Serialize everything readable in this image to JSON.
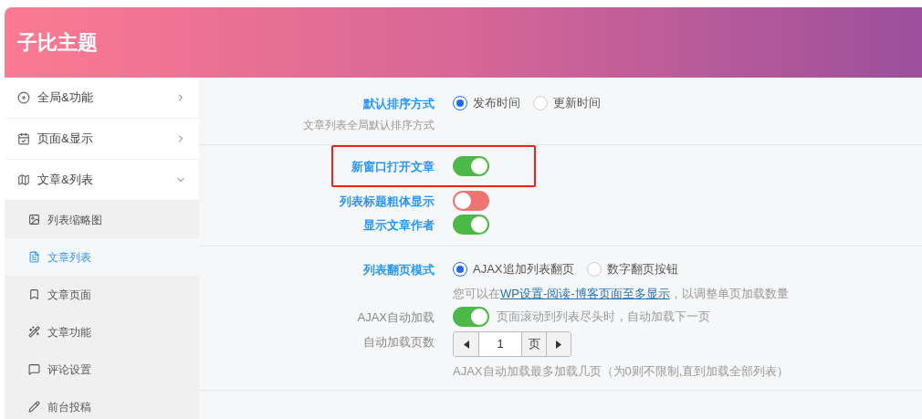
{
  "header": {
    "title": "子比主题"
  },
  "sidebar": {
    "items": [
      {
        "label": "全局&功能",
        "expanded": false
      },
      {
        "label": "页面&显示",
        "expanded": false
      },
      {
        "label": "文章&列表",
        "expanded": true,
        "children": [
          {
            "label": "列表缩略图",
            "selected": false
          },
          {
            "label": "文章列表",
            "selected": true
          },
          {
            "label": "文章页面",
            "selected": false
          },
          {
            "label": "文章功能",
            "selected": false
          },
          {
            "label": "评论设置",
            "selected": false
          },
          {
            "label": "前台投稿",
            "selected": false
          }
        ]
      }
    ]
  },
  "sections": [
    {
      "fields": [
        {
          "kind": "radio",
          "label": "默认排序方式",
          "muted": false,
          "highlighted": false,
          "desc_left": "文章列表全局默认排序方式",
          "options": [
            {
              "label": "发布时间",
              "selected": true
            },
            {
              "label": "更新时间",
              "selected": false
            }
          ]
        }
      ]
    },
    {
      "fields": [
        {
          "kind": "toggle",
          "label": "新窗口打开文章",
          "muted": false,
          "highlighted": true,
          "on": true
        },
        {
          "kind": "toggle",
          "label": "列表标题粗体显示",
          "muted": false,
          "highlighted": false,
          "on": false
        },
        {
          "kind": "toggle",
          "label": "显示文章作者",
          "muted": false,
          "highlighted": false,
          "on": true
        }
      ]
    },
    {
      "fields": [
        {
          "kind": "radio",
          "label": "列表翻页模式",
          "muted": false,
          "highlighted": false,
          "options": [
            {
              "label": "AJAX追加列表翻页",
              "selected": true
            },
            {
              "label": "数字翻页按钮",
              "selected": false
            }
          ],
          "help": {
            "before": "您可以在",
            "link": "WP设置-阅读-博客页面至多显示",
            "after": "，以调整单页加载数量"
          }
        },
        {
          "kind": "toggle",
          "label": "AJAX自动加载",
          "muted": true,
          "highlighted": false,
          "on": true,
          "note": "页面滚动到列表尽头时，自动加载下一页"
        },
        {
          "kind": "number",
          "label": "自动加载页数",
          "muted": true,
          "highlighted": false,
          "value": "1",
          "unit": "页",
          "help_text": "AJAX自动加载最多加载几页（为0则不限制,直到加载全部列表）"
        }
      ]
    }
  ]
}
